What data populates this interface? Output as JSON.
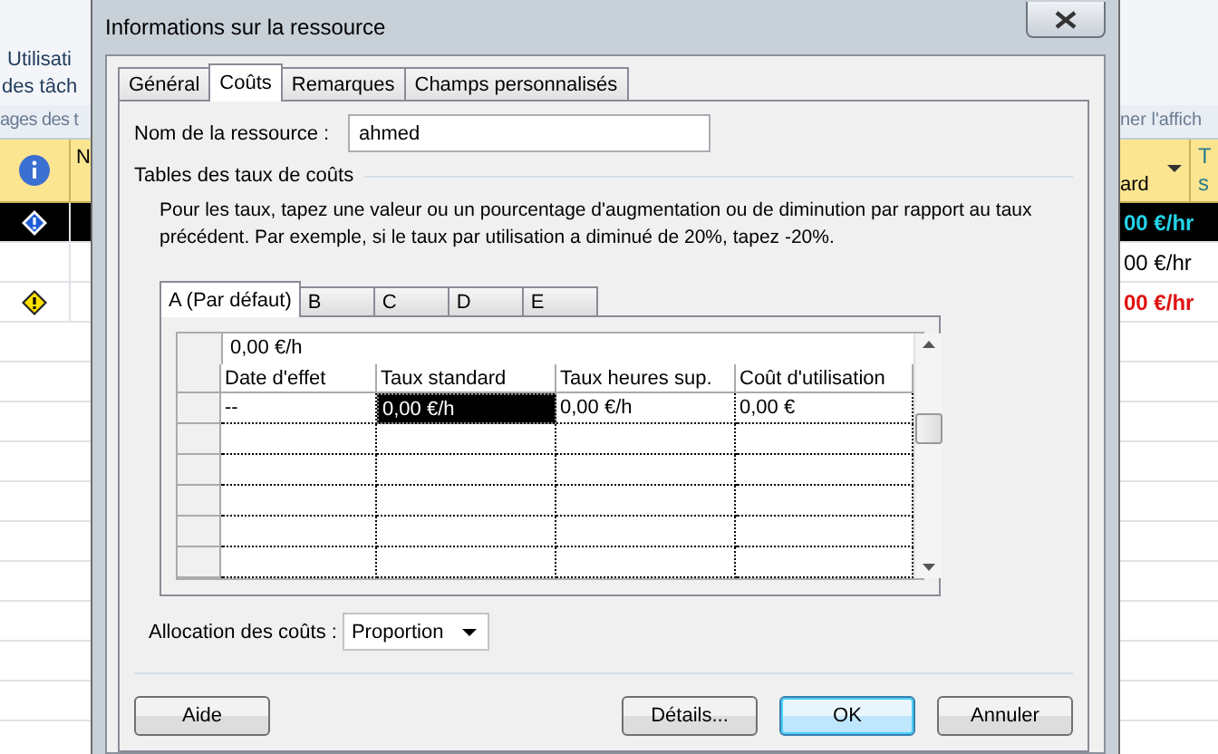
{
  "background": {
    "ribbon_lines": [
      "Utilisati",
      "des tâch"
    ],
    "group_label_left": "ages des t",
    "group_label_right": "ner l'affich",
    "column_left": "N",
    "column_right": "ard",
    "column_right_2": [
      "T",
      "s"
    ],
    "rows": [
      {
        "kind": "selected",
        "rate": "00 €/hr"
      },
      {
        "kind": "normal",
        "rate": "00 €/hr"
      },
      {
        "kind": "overallocated",
        "rate": "00 €/hr"
      }
    ]
  },
  "dialog": {
    "title": "Informations sur la ressource",
    "tabs": [
      {
        "label": "Général",
        "selected": false
      },
      {
        "label": "Coûts",
        "selected": true
      },
      {
        "label": "Remarques",
        "selected": false
      },
      {
        "label": "Champs personnalisés",
        "selected": false
      }
    ],
    "name_label": {
      "text": "Nom de la ressource :"
    },
    "name_value": "ahmed",
    "group_title": {
      "text": "Tables des taux de coûts"
    },
    "instructions": "Pour les taux, tapez une valeur ou un pourcentage d'augmentation ou de diminution par rapport au taux précédent. Par exemple, si le taux par utilisation a diminué de 20%, tapez -20%.",
    "rate_tabs": [
      {
        "label": "A (Par défaut)",
        "selected": true
      },
      {
        "label": "B",
        "selected": false
      },
      {
        "label": "C",
        "selected": false
      },
      {
        "label": "D",
        "selected": false
      },
      {
        "label": "E",
        "selected": false
      }
    ],
    "edit_value": "0,00 €/h",
    "columns": [
      "Date d'effet",
      "Taux standard",
      "Taux heures sup.",
      "Coût d'utilisation"
    ],
    "rows": [
      {
        "cells": [
          {
            "text": "--",
            "selected": false
          },
          {
            "text": "0,00 €/h",
            "selected": true
          },
          {
            "text": "0,00 €/h",
            "selected": false
          },
          {
            "text": "0,00 €",
            "selected": false
          }
        ]
      }
    ],
    "allocation_label": {
      "text": "Allocation des coûts :"
    },
    "allocation_value": "Proportion",
    "buttons": [
      {
        "label": "Aide",
        "default": false,
        "kind": "left"
      },
      {
        "label": "Détails...",
        "default": false,
        "kind": "right"
      },
      {
        "label": "OK",
        "default": true,
        "kind": "right"
      },
      {
        "label": "Annuler",
        "default": false,
        "kind": "right"
      }
    ]
  }
}
